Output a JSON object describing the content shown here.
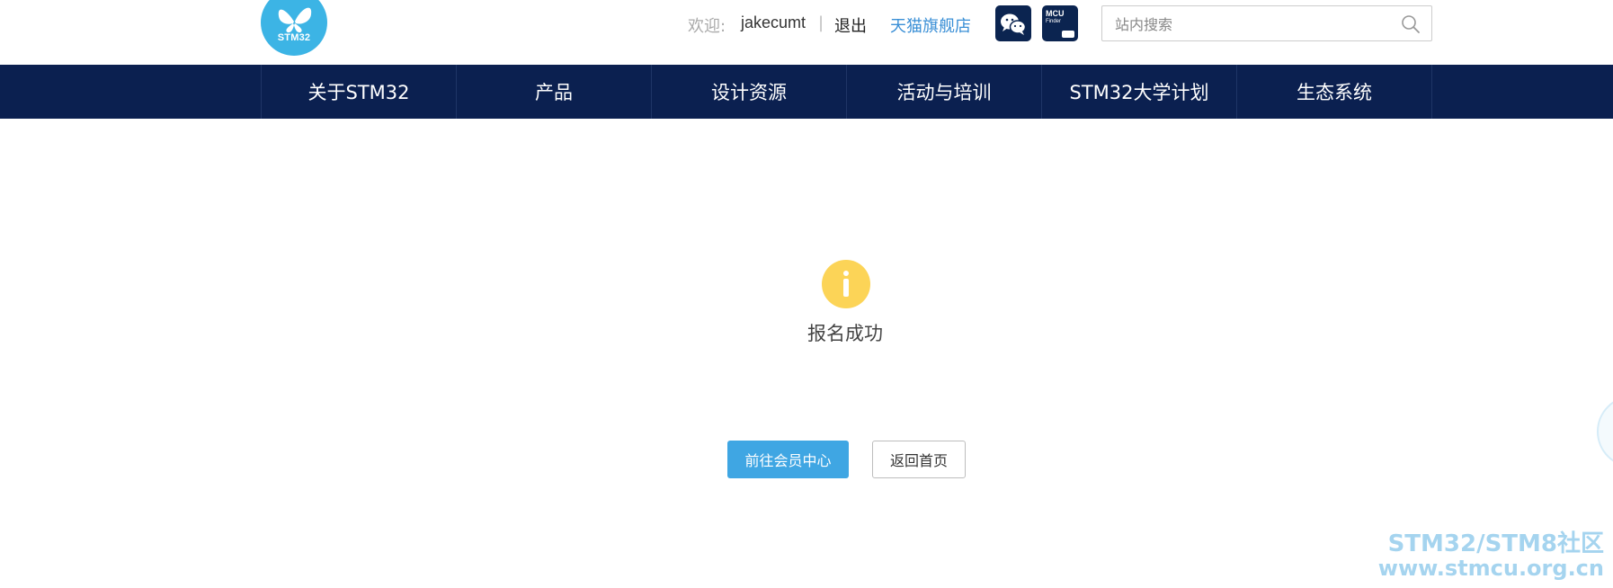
{
  "header": {
    "logo_text": "STM32",
    "welcome_label": "欢迎:",
    "username": "jakecumt",
    "separator": "|",
    "logout_label": "退出",
    "tmall_label": "天猫旗舰店",
    "mcu_finder": {
      "line1": "MCU",
      "line2": "Finder"
    },
    "search": {
      "placeholder": "站内搜索",
      "value": ""
    }
  },
  "nav": {
    "items": [
      {
        "label": "关于STM32"
      },
      {
        "label": "产品"
      },
      {
        "label": "设计资源"
      },
      {
        "label": "活动与培训"
      },
      {
        "label": "STM32大学计划"
      },
      {
        "label": "生态系统"
      }
    ]
  },
  "main": {
    "message": "报名成功",
    "primary_button": "前往会员中心",
    "secondary_button": "返回首页"
  },
  "watermark": {
    "line1": "STM32/STM8社区",
    "line2": "www.stmcu.org.cn"
  },
  "colors": {
    "brand_blue": "#3cb4e5",
    "nav_bg": "#0b2050",
    "primary_button": "#3fa6e3",
    "info_icon": "#fcd457",
    "link": "#3a8fd6"
  }
}
